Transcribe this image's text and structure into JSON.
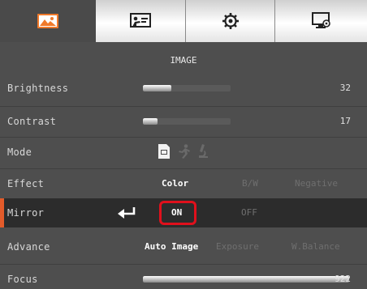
{
  "tabs": [
    {
      "name": "tab-image",
      "icon": "picture-icon",
      "active": true
    },
    {
      "name": "tab-presentation",
      "icon": "presenter-icon",
      "active": false
    },
    {
      "name": "tab-settings",
      "icon": "gear-icon",
      "active": false
    },
    {
      "name": "tab-display",
      "icon": "monitor-settings-icon",
      "active": false
    }
  ],
  "section_title": "IMAGE",
  "rows": {
    "brightness": {
      "label": "Brightness",
      "value": "32",
      "level": 0.32
    },
    "contrast": {
      "label": "Contrast",
      "value": "17",
      "level": 0.17
    },
    "mode": {
      "label": "Mode",
      "icons": [
        "document-icon",
        "motion-runner-icon",
        "microscope-icon"
      ],
      "selected": "document-icon"
    },
    "effect": {
      "label": "Effect",
      "options": [
        "Color",
        "B/W",
        "Negative"
      ],
      "selected": "Color"
    },
    "mirror": {
      "label": "Mirror",
      "options": [
        "ON",
        "OFF"
      ],
      "selected": "ON",
      "enter_icon": "enter-arrow-icon"
    },
    "advance": {
      "label": "Advance",
      "options": [
        "Auto Image",
        "Exposure",
        "W.Balance"
      ],
      "selected": "Auto Image"
    },
    "focus": {
      "label": "Focus",
      "value": "922"
    }
  },
  "colors": {
    "accent": "#e35b2a",
    "highlight_box": "#e0101c",
    "background": "#4e4e4e"
  }
}
